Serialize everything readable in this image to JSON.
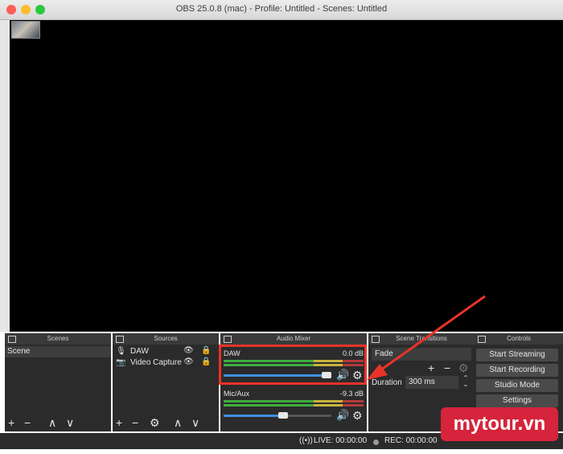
{
  "window": {
    "title": "OBS 25.0.8 (mac) - Profile: Untitled - Scenes: Untitled"
  },
  "scenes": {
    "header": "Scenes",
    "items": [
      "Scene"
    ]
  },
  "sources": {
    "header": "Sources",
    "items": [
      "DAW",
      "Video Capture"
    ]
  },
  "mixer": {
    "header": "Audio Mixer",
    "tracks": [
      {
        "name": "DAW",
        "db": "0.0 dB",
        "volume_fraction": 1.0
      },
      {
        "name": "Mic/Aux",
        "db": "-9.3 dB",
        "volume_fraction": 0.6
      }
    ]
  },
  "transitions": {
    "header": "Scene Transitions",
    "selected": "Fade",
    "duration_label": "Duration",
    "duration_value": "300 ms"
  },
  "controls": {
    "header": "Controls",
    "buttons": [
      "Start Streaming",
      "Start Recording",
      "Studio Mode",
      "Settings"
    ]
  },
  "status": {
    "live": "LIVE: 00:00:00",
    "rec": "REC: 00:00:00"
  },
  "watermark": {
    "text": "mytour.vn"
  }
}
